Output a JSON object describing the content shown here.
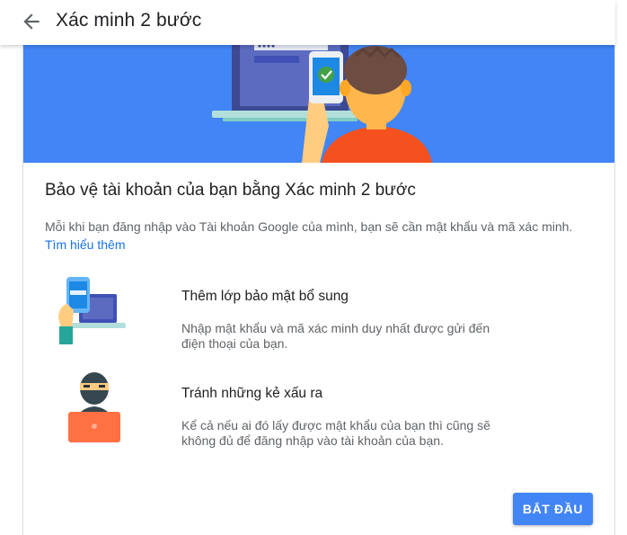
{
  "header": {
    "back_icon": "arrow-back-icon",
    "title": "Xác minh 2 bước"
  },
  "hero": {
    "illustration": "laptop-phone-verification-illustration"
  },
  "card": {
    "title": "Bảo vệ tài khoản của bạn bằng Xác minh 2 bước",
    "intro": "Mỗi khi bạn đăng nhập vào Tài khoản Google của mình, bạn sẽ cần mật khẩu và mã xác minh.",
    "learn_more": "Tìm hiểu thêm"
  },
  "features": [
    {
      "icon": "phone-laptop-security-icon",
      "title": "Thêm lớp bảo mật bổ sung",
      "description": "Nhập mật khẩu và mã xác minh duy nhất được gửi đến điện thoại của bạn."
    },
    {
      "icon": "hacker-laptop-icon",
      "title": "Tránh những kẻ xấu ra",
      "description": "Kể cả nếu ai đó lấy được mật khẩu của bạn thì cũng sẽ không đủ để đăng nhập vào tài khoản của bạn."
    }
  ],
  "actions": {
    "start_label": "BẮT ĐẦU"
  },
  "colors": {
    "accent": "#4285f4",
    "link": "#1a73e8",
    "hero_bg": "#4285f4",
    "person_shirt": "#f4511e"
  }
}
